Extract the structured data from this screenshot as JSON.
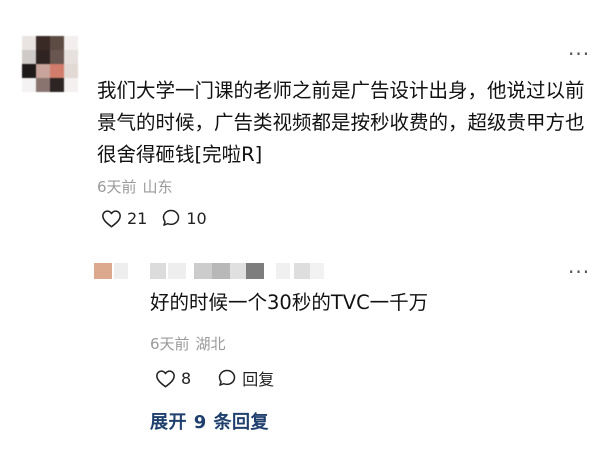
{
  "comment": {
    "text": "我们大学一门课的老师之前是广告设计出身，他说过以前景气的时候，广告类视频都是按秒收费的，超级贵甲方也很舍得砸钱[完啦R]",
    "time": "6天前",
    "location": "山东",
    "likes": "21",
    "replies": "10",
    "more_label": "···"
  },
  "reply": {
    "text": "好的时候一个30秒的TVC一千万",
    "time": "6天前",
    "location": "湖北",
    "likes": "8",
    "reply_label": "回复",
    "more_label": "···"
  },
  "expand_label": "展开 9 条回复",
  "colors": {
    "accent": "#1f3f6d",
    "meta_gray": "#9a9a9a"
  }
}
